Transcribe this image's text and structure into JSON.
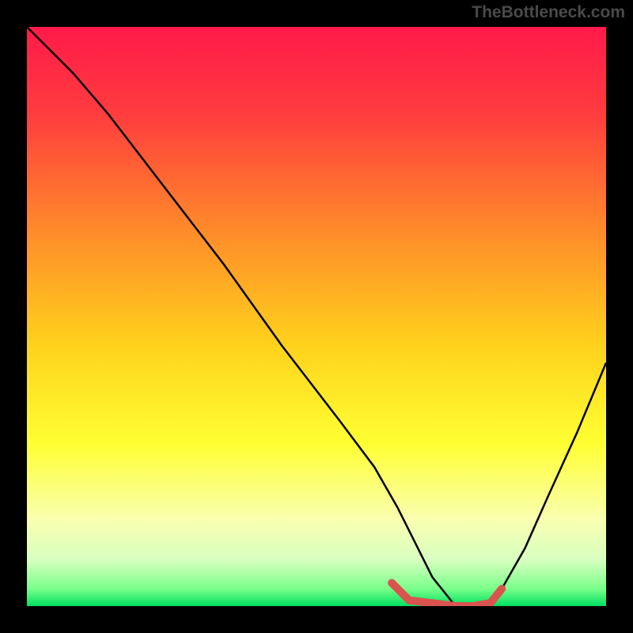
{
  "watermark": "TheBottleneck.com",
  "chart_data": {
    "type": "line",
    "title": "",
    "xlabel": "",
    "ylabel": "",
    "xlim": [
      0,
      100
    ],
    "ylim": [
      0,
      100
    ],
    "background_gradient": {
      "stops": [
        {
          "offset": 0,
          "color": "#ff1a4a"
        },
        {
          "offset": 15,
          "color": "#ff3c3e"
        },
        {
          "offset": 35,
          "color": "#ff8a2a"
        },
        {
          "offset": 55,
          "color": "#ffd21c"
        },
        {
          "offset": 72,
          "color": "#ffff33"
        },
        {
          "offset": 85,
          "color": "#f9ffb0"
        },
        {
          "offset": 92,
          "color": "#d8ffc0"
        },
        {
          "offset": 97,
          "color": "#7aff8a"
        },
        {
          "offset": 100,
          "color": "#00e060"
        }
      ]
    },
    "curve": {
      "x": [
        0,
        4,
        8,
        14,
        24,
        34,
        44,
        54,
        60,
        64,
        67,
        70,
        74,
        77,
        80,
        82,
        86,
        90,
        95,
        100
      ],
      "y": [
        100,
        96,
        92,
        85,
        72,
        59,
        45,
        32,
        24,
        17,
        11,
        5,
        0,
        0,
        0,
        3,
        10,
        19,
        30,
        42
      ]
    },
    "highlight": {
      "color": "#d9544f",
      "x": [
        63,
        66,
        70,
        74,
        77,
        80,
        82
      ],
      "y": [
        4,
        1,
        0.5,
        0,
        0,
        0.5,
        3
      ]
    }
  }
}
